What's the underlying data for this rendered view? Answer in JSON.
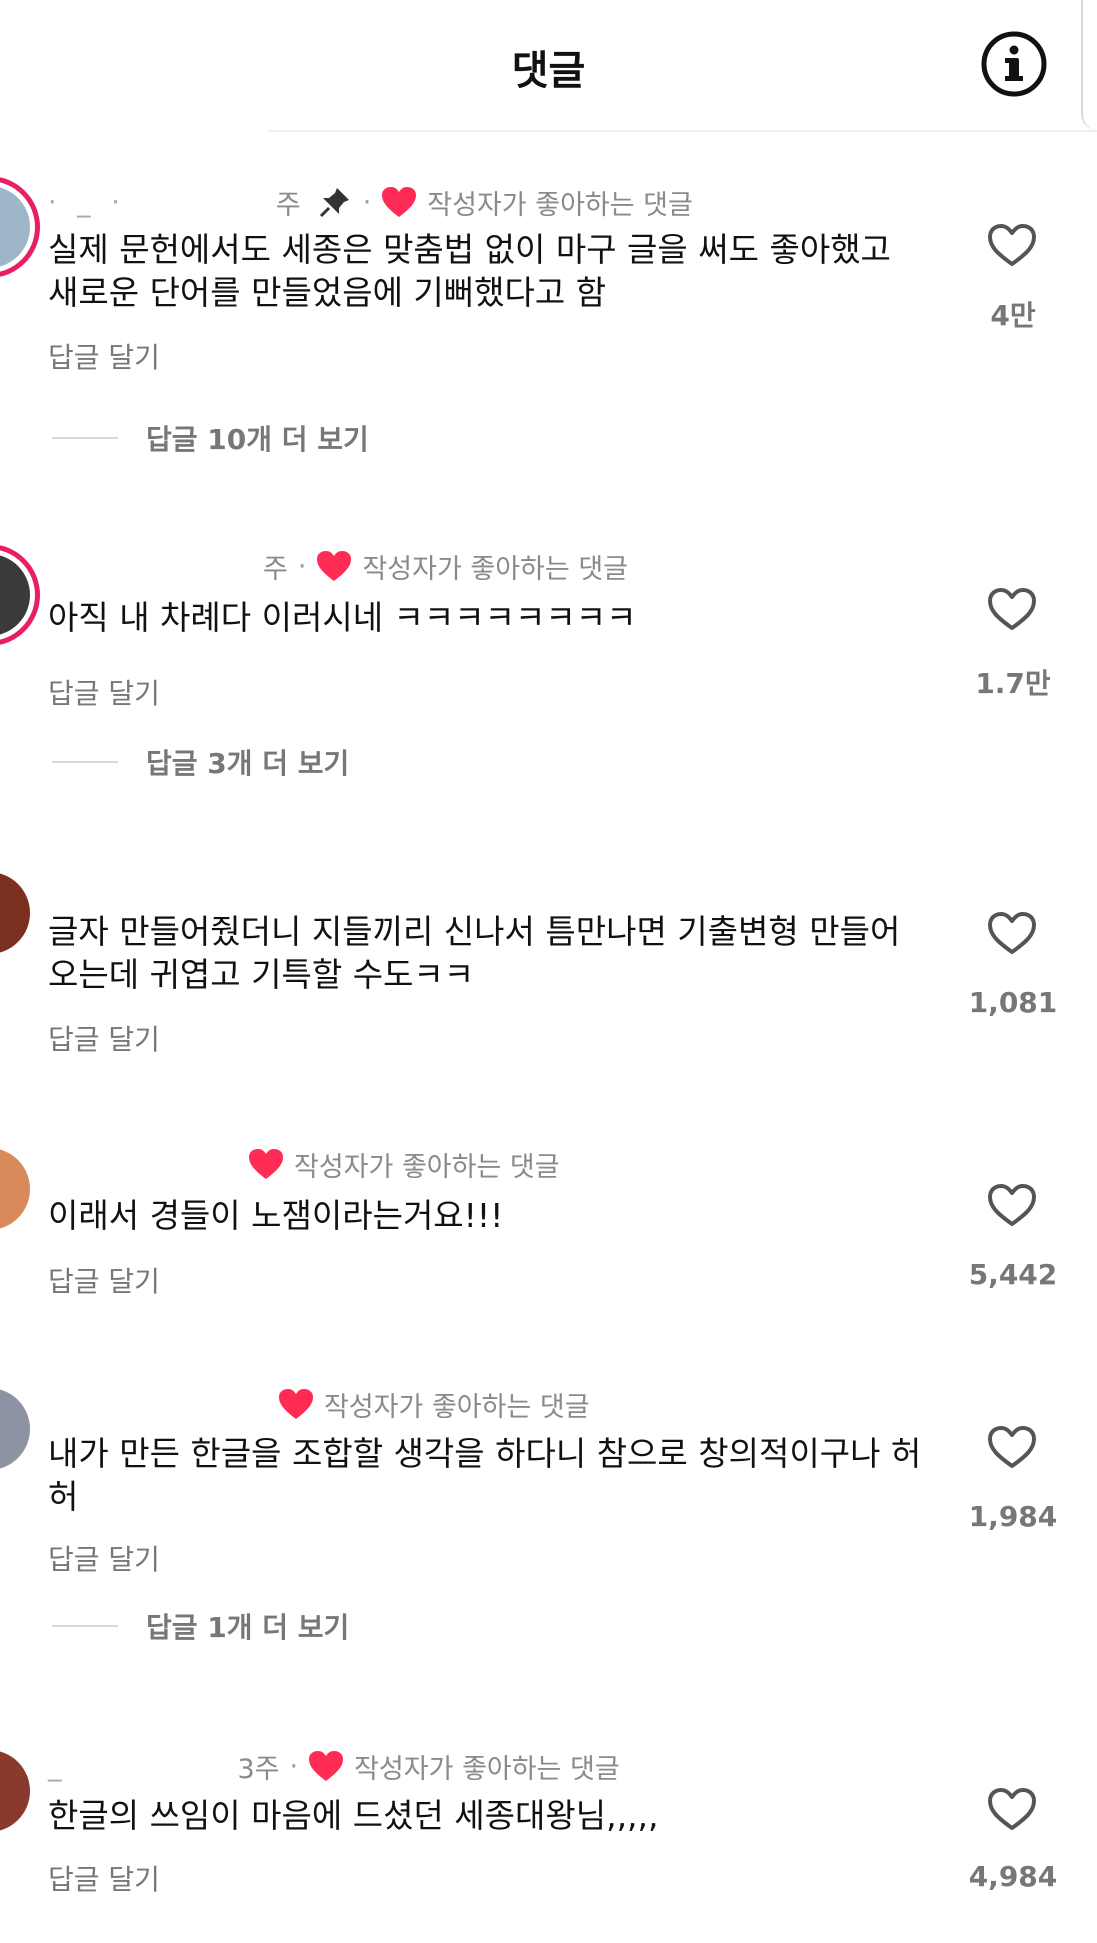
{
  "header": {
    "title": "댓글"
  },
  "creator_label": "작성자가 좋아하는 댓글",
  "reply_label": "답글 달기",
  "comments": [
    {
      "name": "· _ ·",
      "time": "주",
      "text": "실제 문헌에서도 세종은 맞춤법 없이 마구 글을 써도 좋아했고 새로운 단어를 만들었음에 기뻐했다고 함",
      "likes": "4만",
      "more_replies": "답글 10개 더 보기",
      "pinned": true
    },
    {
      "name": "",
      "time": "주",
      "text": "아직 내 차례다 이러시네 ㅋㅋㅋㅋㅋㅋㅋㅋ",
      "likes": "1.7만",
      "more_replies": "답글 3개 더 보기"
    },
    {
      "name": "",
      "time": "",
      "text": "글자 만들어줬더니 지들끼리 신나서 틈만나면 기출변형 만들어 오는데 귀엽고 기특할 수도ㅋㅋ",
      "likes": "1,081"
    },
    {
      "name": "",
      "time": "",
      "text": "이래서 경들이 노잼이라는거요!!!",
      "likes": "5,442"
    },
    {
      "name": "",
      "time": "",
      "text": "내가 만든 한글을 조합할 생각을 하다니 참으로 창의적이구나 허허",
      "likes": "1,984",
      "more_replies": "답글 1개 더 보기"
    },
    {
      "name": "_",
      "time": "3주",
      "text": "한글의 쓰임이 마음에 드셨던 세종대왕님,,,,,",
      "likes": "4,984"
    }
  ],
  "colors": {
    "heart": "#fe2c55",
    "ring": "#e91e63",
    "muted": "#777777"
  }
}
